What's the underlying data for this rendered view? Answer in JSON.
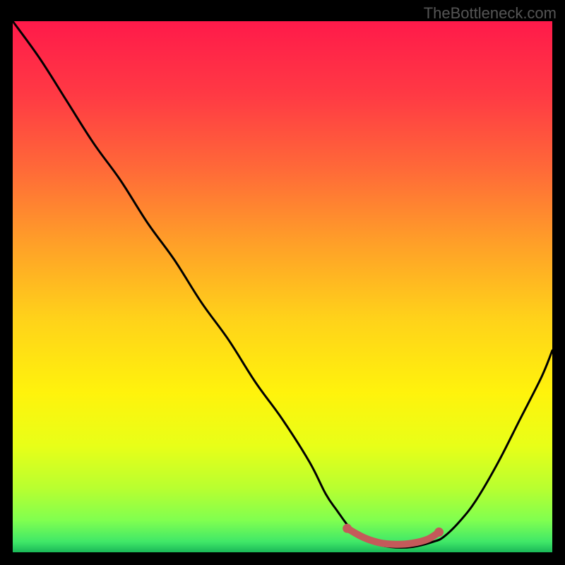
{
  "watermark": "TheBottleneck.com",
  "chart_data": {
    "type": "line",
    "title": "",
    "xlabel": "",
    "ylabel": "",
    "xlim": [
      0,
      100
    ],
    "ylim": [
      0,
      100
    ],
    "grid": false,
    "legend": false,
    "series": [
      {
        "name": "bottleneck-curve",
        "x": [
          0,
          5,
          10,
          15,
          20,
          25,
          30,
          35,
          40,
          45,
          50,
          55,
          58,
          60,
          63,
          66,
          70,
          74,
          78,
          80,
          83,
          86,
          90,
          94,
          98,
          100
        ],
        "values": [
          100,
          93,
          85,
          77,
          70,
          62,
          55,
          47,
          40,
          32,
          25,
          17,
          11,
          8,
          4,
          2,
          1,
          1,
          2,
          3,
          6,
          10,
          17,
          25,
          33,
          38
        ]
      }
    ],
    "highlight": {
      "name": "optimal-range",
      "x": [
        62,
        65,
        68,
        71,
        74,
        77,
        79
      ],
      "values": [
        4.5,
        2.8,
        1.8,
        1.5,
        1.7,
        2.5,
        3.8
      ],
      "color": "#c45a5a"
    },
    "gradient_stops": [
      {
        "offset": 0.0,
        "color": "#ff1a4a"
      },
      {
        "offset": 0.14,
        "color": "#ff3a44"
      },
      {
        "offset": 0.28,
        "color": "#ff6a38"
      },
      {
        "offset": 0.42,
        "color": "#ffa028"
      },
      {
        "offset": 0.56,
        "color": "#ffd21a"
      },
      {
        "offset": 0.7,
        "color": "#fff30c"
      },
      {
        "offset": 0.8,
        "color": "#e8ff18"
      },
      {
        "offset": 0.88,
        "color": "#b8ff30"
      },
      {
        "offset": 0.94,
        "color": "#80ff50"
      },
      {
        "offset": 0.98,
        "color": "#40e868"
      },
      {
        "offset": 1.0,
        "color": "#1ab858"
      }
    ]
  }
}
